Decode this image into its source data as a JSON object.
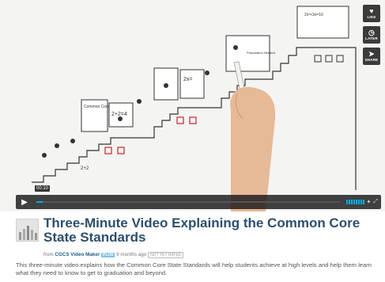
{
  "player": {
    "side_buttons": [
      {
        "label": "LIKE",
        "icon": "heart-icon",
        "glyph": "♥"
      },
      {
        "label": "LATER",
        "icon": "clock-icon",
        "glyph": "◷"
      },
      {
        "label": "SHARE",
        "icon": "paper-plane-icon",
        "glyph": "➤"
      }
    ],
    "current_time": "00:10",
    "play_glyph": "▶",
    "progress_fraction": 0.02,
    "accent_color": "#00adef",
    "art": {
      "eq1": "2+2",
      "eq2": "2+2=4",
      "eq3": "2x=",
      "eq4": "2x³+3x=10",
      "board_title": "Common Core",
      "sign": "Preparation Needed"
    }
  },
  "video": {
    "title": "Three-Minute Video Explaining the Common Core State Standards",
    "from_label": "from",
    "author": "CGCS Video Maker",
    "plus_badge": "PLUS",
    "time_ago": "9 months ago",
    "rating_badge": "NOT YET RATED",
    "description": "This three-minute video explains how the Common Core State Standards will help students achieve at high levels and help them learn what they need to know to get to graduation and beyond."
  }
}
